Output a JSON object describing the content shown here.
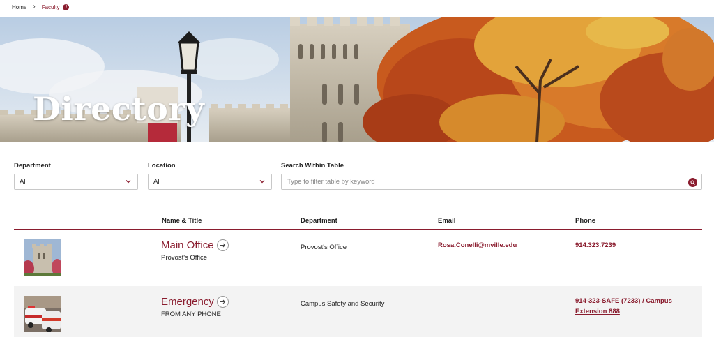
{
  "breadcrumb": {
    "home": "Home",
    "separator": "›",
    "current": "Faculty",
    "info_icon": "info-icon",
    "info_glyph": "!"
  },
  "hero": {
    "title": "Directory"
  },
  "filters": {
    "department": {
      "label": "Department",
      "value": "All"
    },
    "location": {
      "label": "Location",
      "value": "All"
    },
    "search": {
      "label": "Search Within Table",
      "placeholder": "Type to filter table by keyword"
    }
  },
  "table": {
    "headers": [
      "Name & Title",
      "Department",
      "Email",
      "Phone"
    ],
    "rows": [
      {
        "name": "Main Office",
        "title": "Provost's Office",
        "department": "Provost's Office",
        "email": "Rosa.Conelli@mville.edu",
        "phone": "914.323.7239",
        "phone_line2": ""
      },
      {
        "name": "Emergency",
        "title": "FROM ANY PHONE",
        "department": "Campus Safety and Security",
        "email": "",
        "phone": "914-323-SAFE (7233) / Campus",
        "phone_line2": "Extension 888"
      }
    ]
  },
  "colors": {
    "accent": "#8a1c2e"
  }
}
